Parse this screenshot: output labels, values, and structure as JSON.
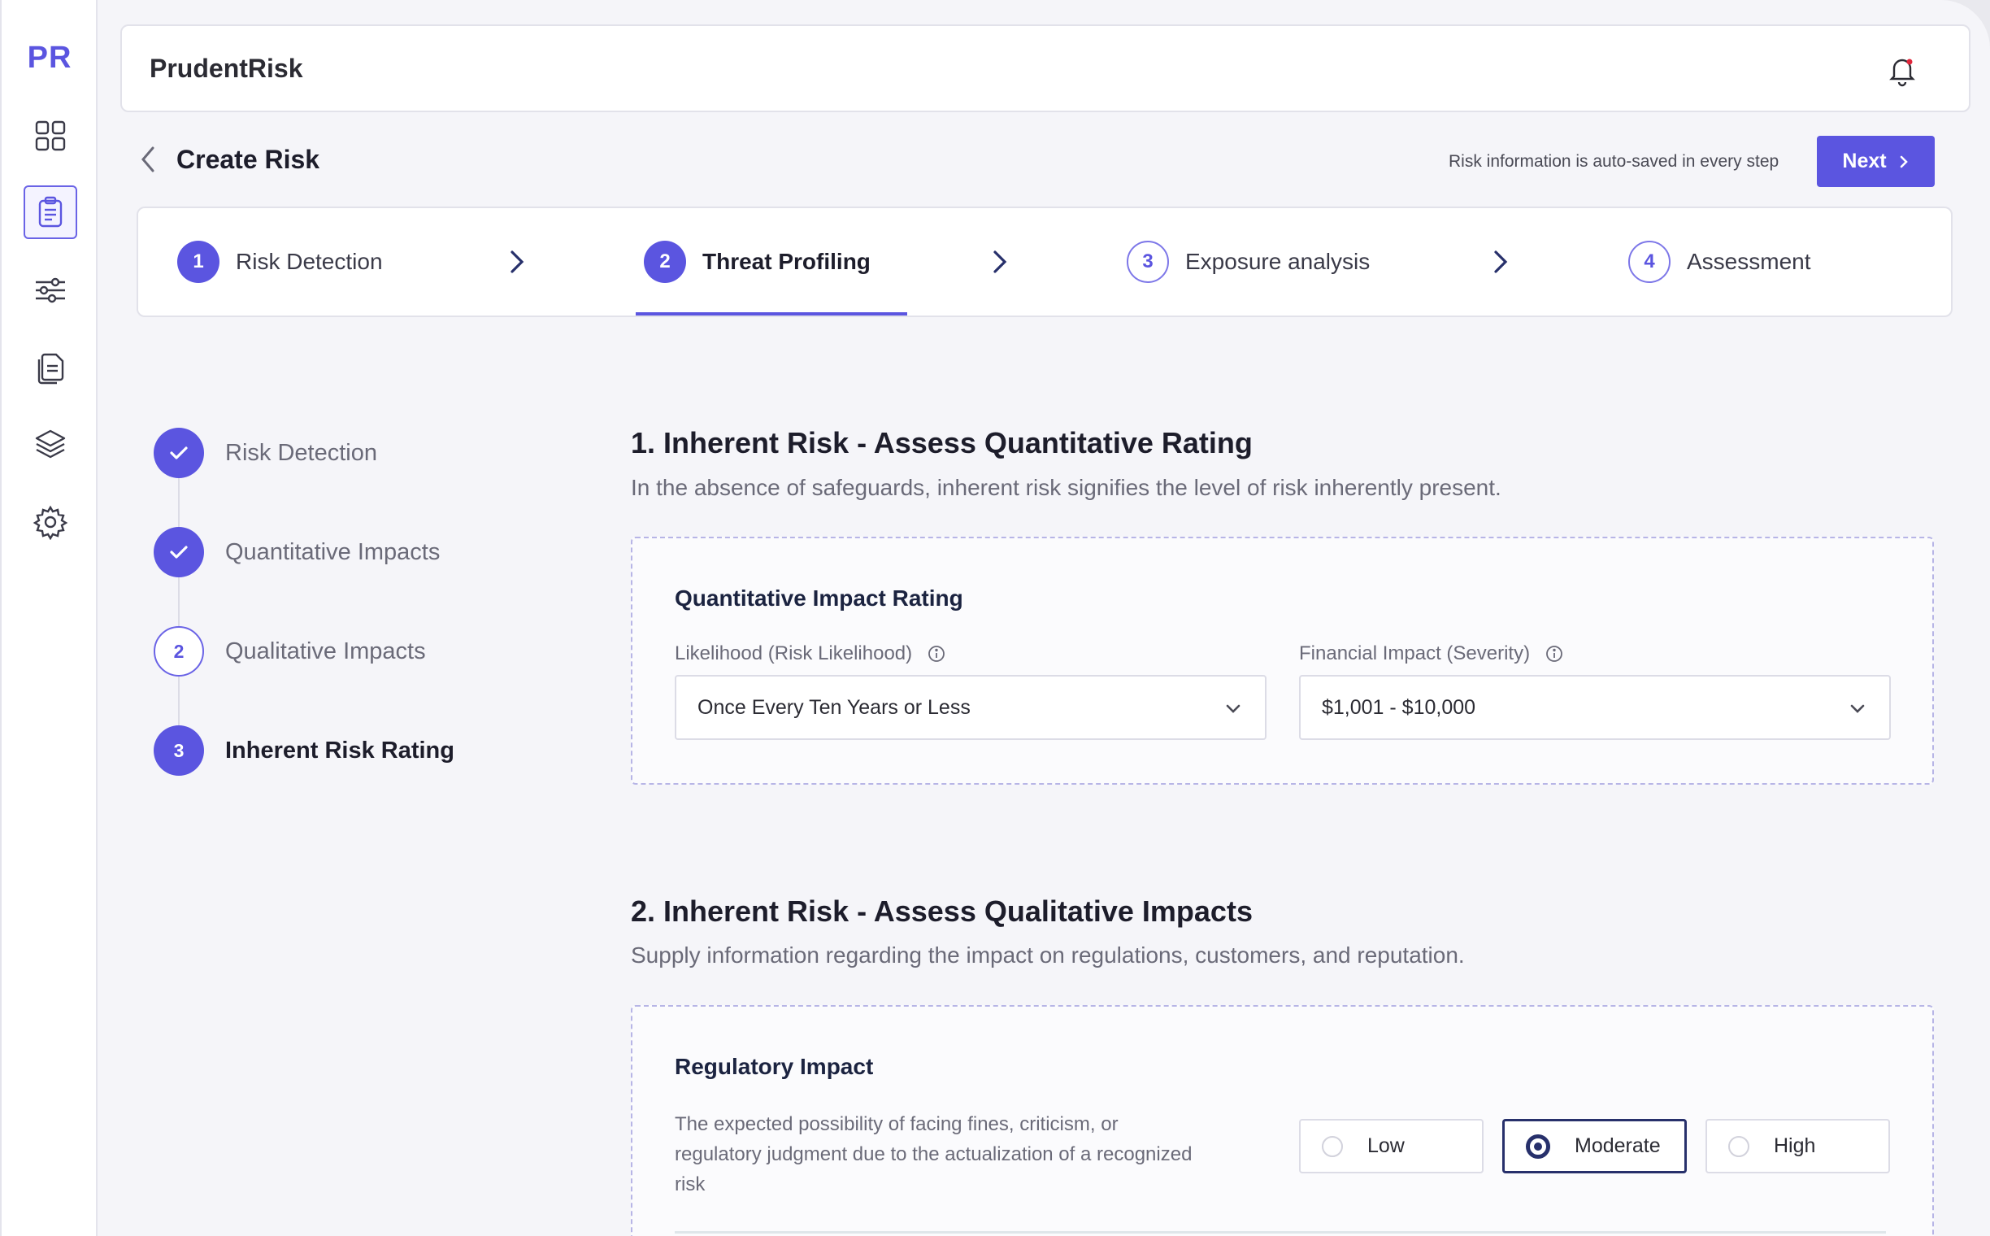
{
  "app": {
    "logo": "PR",
    "brand": "PrudentRisk"
  },
  "sidebar": {
    "items": [
      {
        "icon": "dashboard-grid-icon"
      },
      {
        "icon": "clipboard-icon",
        "active": true
      },
      {
        "icon": "sliders-icon"
      },
      {
        "icon": "documents-icon"
      },
      {
        "icon": "layers-icon"
      },
      {
        "icon": "gear-icon"
      }
    ]
  },
  "header": {
    "title": "Create Risk",
    "autosave_note": "Risk information is auto-saved in every step",
    "next_label": "Next"
  },
  "stepper": {
    "steps": [
      {
        "num": "1",
        "label": "Risk Detection",
        "state": "done"
      },
      {
        "num": "2",
        "label": "Threat Profiling",
        "state": "active"
      },
      {
        "num": "3",
        "label": "Exposure analysis",
        "state": "todo"
      },
      {
        "num": "4",
        "label": "Assessment",
        "state": "todo"
      }
    ]
  },
  "progress": {
    "items": [
      {
        "num": "",
        "label": "Risk Detection",
        "state": "done"
      },
      {
        "num": "",
        "label": "Quantitative Impacts",
        "state": "done"
      },
      {
        "num": "2",
        "label": "Qualitative Impacts",
        "state": "todo"
      },
      {
        "num": "3",
        "label": "Inherent Risk Rating",
        "state": "current"
      }
    ]
  },
  "section1": {
    "title": "1. Inherent Risk - Assess Quantitative Rating",
    "subtitle": "In the absence of safeguards, inherent risk signifies the level of risk inherently present.",
    "card_title": "Quantitative Impact Rating",
    "likelihood": {
      "label": "Likelihood (Risk Likelihood)",
      "value": "Once Every Ten Years or Less"
    },
    "financial": {
      "label": "Financial Impact (Severity)",
      "value": "$1,001 - $10,000"
    }
  },
  "section2": {
    "title": "2. Inherent Risk - Assess Qualitative Impacts",
    "subtitle": "Supply information regarding the impact on regulations, customers, and reputation.",
    "card_title": "Regulatory Impact",
    "description": "The expected possibility of facing fines, criticism, or regulatory judgment due to the actualization of a recognized risk",
    "options": [
      "Low",
      "Moderate",
      "High"
    ],
    "selected": "Moderate"
  },
  "colors": {
    "accent": "#5b55e0",
    "selected_radio": "#27306b",
    "background": "#f5f5f9"
  }
}
